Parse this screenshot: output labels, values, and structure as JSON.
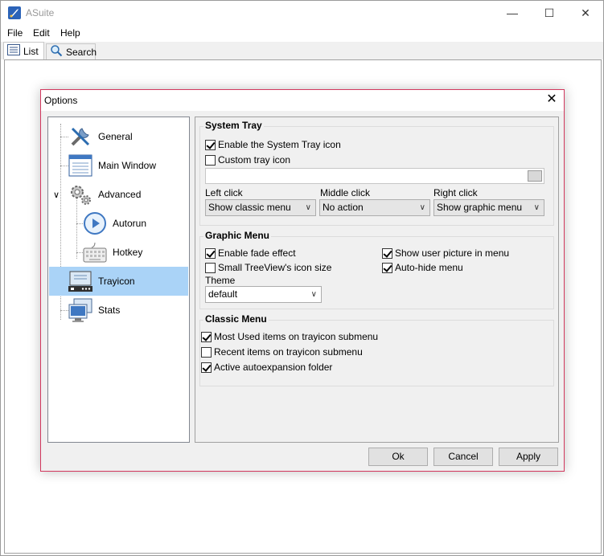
{
  "window": {
    "title": "ASuite"
  },
  "menus": [
    "File",
    "Edit",
    "Help"
  ],
  "tabs": [
    {
      "label": "List",
      "icon": "list-icon"
    },
    {
      "label": "Search",
      "icon": "search-icon"
    }
  ],
  "dialog": {
    "title": "Options",
    "tree": [
      {
        "label": "General",
        "icon": "tools-icon"
      },
      {
        "label": "Main Window",
        "icon": "window-icon"
      },
      {
        "label": "Advanced",
        "icon": "gears-icon",
        "expanded": true
      },
      {
        "label": "Autorun",
        "icon": "play-icon"
      },
      {
        "label": "Hotkey",
        "icon": "keyboard-icon"
      },
      {
        "label": "Trayicon",
        "icon": "trayicon-icon",
        "selected": true
      },
      {
        "label": "Stats",
        "icon": "stats-icon"
      }
    ],
    "system_tray": {
      "title": "System Tray",
      "enable_label": "Enable the System Tray icon",
      "enable_checked": true,
      "custom_label": "Custom tray icon",
      "custom_checked": false,
      "custom_path": "",
      "left_click_label": "Left click",
      "left_click_value": "Show classic menu",
      "middle_click_label": "Middle click",
      "middle_click_value": "No action",
      "right_click_label": "Right click",
      "right_click_value": "Show graphic menu"
    },
    "graphic_menu": {
      "title": "Graphic Menu",
      "fade_label": "Enable fade effect",
      "fade_checked": true,
      "small_icon_label": "Small TreeView's icon size",
      "small_icon_checked": false,
      "user_picture_label": "Show user picture in menu",
      "user_picture_checked": true,
      "autohide_label": "Auto-hide menu",
      "autohide_checked": true,
      "theme_label": "Theme",
      "theme_value": "default"
    },
    "classic_menu": {
      "title": "Classic Menu",
      "most_used_label": "Most Used items on trayicon submenu",
      "most_used_checked": true,
      "recent_label": "Recent items on trayicon submenu",
      "recent_checked": false,
      "autoexpansion_label": "Active autoexpansion folder",
      "autoexpansion_checked": true
    },
    "buttons": {
      "ok": "Ok",
      "cancel": "Cancel",
      "apply": "Apply"
    }
  }
}
